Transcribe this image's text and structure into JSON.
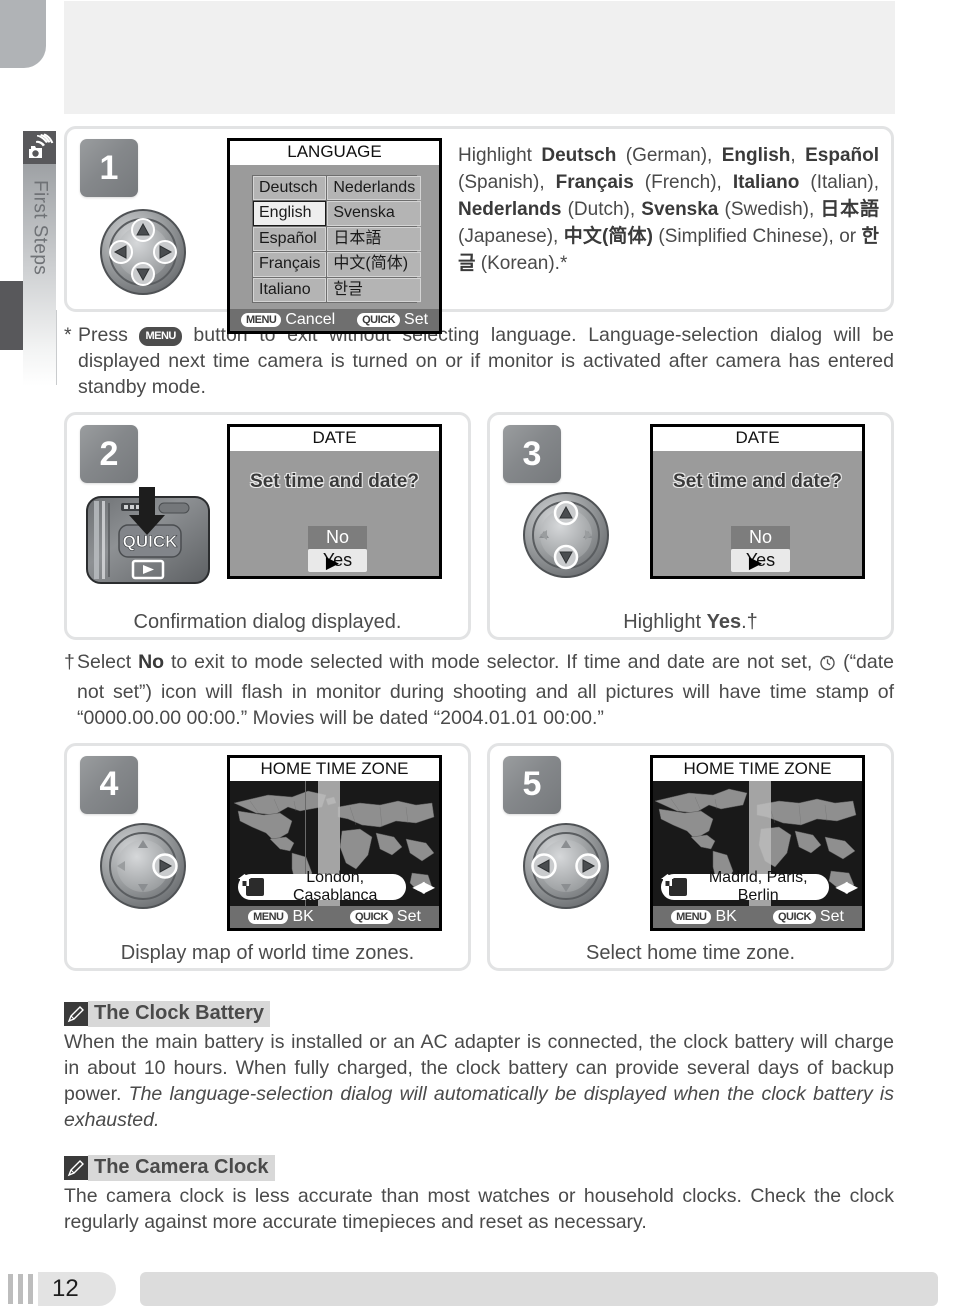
{
  "sidebar": {
    "chapter_label": "First Steps",
    "icon": "camera-hand-icon"
  },
  "footer": {
    "page_number": "12"
  },
  "steps": [
    {
      "number": "1",
      "control": "multi-selector-up-down",
      "screen": {
        "type": "language-menu",
        "title": "LANGUAGE",
        "left_column": [
          "Deutsch",
          "English",
          "Español",
          "Français",
          "Italiano"
        ],
        "right_column": [
          "Nederlands",
          "Svenska",
          "日本語",
          "中文(简体)",
          "한글"
        ],
        "selected": "English",
        "footer_left_key": "MENU",
        "footer_left_label": "Cancel",
        "footer_right_key": "QUICK",
        "footer_right_label": "Set"
      },
      "caption": ""
    },
    {
      "number": "2",
      "control": "camera-quick-button",
      "camera": {
        "button_label": "QUICK",
        "play_icon": "play-icon"
      },
      "screen": {
        "type": "date-confirm",
        "title": "DATE",
        "question": "Set time and date?",
        "option_no": "No",
        "option_yes": "Yes",
        "selected": "Yes"
      },
      "caption": "Confirmation dialog displayed."
    },
    {
      "number": "3",
      "control": "multi-selector-up-down",
      "screen": {
        "type": "date-confirm",
        "title": "DATE",
        "question": "Set time and date?",
        "option_no": "No",
        "option_yes": "Yes",
        "selected": "Yes"
      },
      "caption_prefix": "Highlight ",
      "caption_bold": "Yes",
      "caption_suffix": ".†"
    },
    {
      "number": "4",
      "control": "multi-selector-right",
      "screen": {
        "type": "home-time-zone",
        "title": "HOME TIME ZONE",
        "city": "London, Casablanca",
        "home_icon": "home-icon",
        "footer_left_key": "MENU",
        "footer_left_label": "BK",
        "footer_right_key": "QUICK",
        "footer_right_label": "Set"
      },
      "caption": "Display map of world time zones."
    },
    {
      "number": "5",
      "control": "multi-selector-left-right",
      "screen": {
        "type": "home-time-zone",
        "title": "HOME TIME ZONE",
        "city": "Madrid, Paris, Berlin",
        "home_icon": "home-icon",
        "footer_left_key": "MENU",
        "footer_left_label": "BK",
        "footer_right_key": "QUICK",
        "footer_right_label": "Set"
      },
      "caption": "Select home time zone."
    }
  ],
  "step1_text": {
    "lead": "Highlight ",
    "items": [
      {
        "name": "Deutsch",
        "gloss": " (German), "
      },
      {
        "name": "English",
        "gloss": ", "
      },
      {
        "name": "Español",
        "gloss": " (Spanish), "
      },
      {
        "name": "Français",
        "gloss": " (French), "
      },
      {
        "name": "Italiano",
        "gloss": " (Italian), "
      },
      {
        "name": "Nederlands",
        "gloss": " (Dutch), "
      },
      {
        "name": "Svenska",
        "gloss": " (Swedish), "
      },
      {
        "name": "日本語",
        "gloss": " (Japanese), "
      },
      {
        "name": "中文(简体)",
        "gloss": " (Simplified Chinese), or "
      },
      {
        "name": "한글",
        "gloss": " (Korean).*"
      }
    ]
  },
  "footnote_star": {
    "marker": "*",
    "before_key": " Press ",
    "key": "MENU",
    "after_key": " button to exit without selecting language.  Language-selection dialog will be displayed next time camera is turned on or if monitor is activated after camera has entered standby mode."
  },
  "footnote_dagger": {
    "marker": "†",
    "part1": " Select ",
    "bold1": "No",
    "part2": " to exit to mode selected with mode selector.  If time and date are not set, ",
    "icon": "clock-not-set-icon",
    "part3": " (“date not set”) icon will flash in monitor during shooting and all pictures will have time stamp of  “0000.00.00 00:00.”  Movies will be dated “2004.01.01 00:00.”"
  },
  "notes": [
    {
      "icon": "pencil-icon",
      "title": "The Clock Battery",
      "body_normal": "When the main battery is installed or an AC adapter is connected, the clock battery will charge in about 10 hours.  When fully charged, the clock battery can provide several days of backup power.  ",
      "body_italic": "The language-selection dialog will automatically be displayed when the clock battery is exhausted."
    },
    {
      "icon": "pencil-icon",
      "title": "The Camera Clock",
      "body_normal": "The camera clock is less accurate than most watches or household clocks.  Check the clock regularly against more accurate timepieces and reset as necessary.",
      "body_italic": ""
    }
  ],
  "colors": {
    "lcd_bg": "#9b9b9b",
    "lcd_footer": "#6f6f6f",
    "map_bg": "#191919",
    "map_land": "#8f8f8f",
    "badge": "#85888b",
    "note_title_bg": "#d8d8d8"
  }
}
